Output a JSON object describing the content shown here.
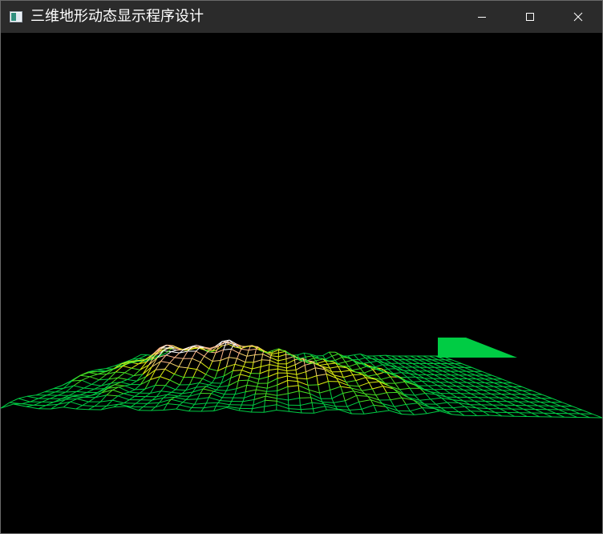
{
  "window": {
    "title": "三维地形动态显示程序设计",
    "controls": {
      "minimize_icon": "minimize-icon",
      "maximize_icon": "maximize-icon",
      "close_icon": "close-icon"
    },
    "colors": {
      "titlebar": "#2b2b2b",
      "title_text": "#ffffff",
      "client_background": "#000000"
    }
  },
  "terrain": {
    "render_mode": "wireframe",
    "elevation_palette": [
      "#00cc44",
      "#44dd22",
      "#ddee11",
      "#f5d36a",
      "#ffb88a",
      "#ffffff"
    ],
    "flat_fill_color": "#00cc44"
  }
}
